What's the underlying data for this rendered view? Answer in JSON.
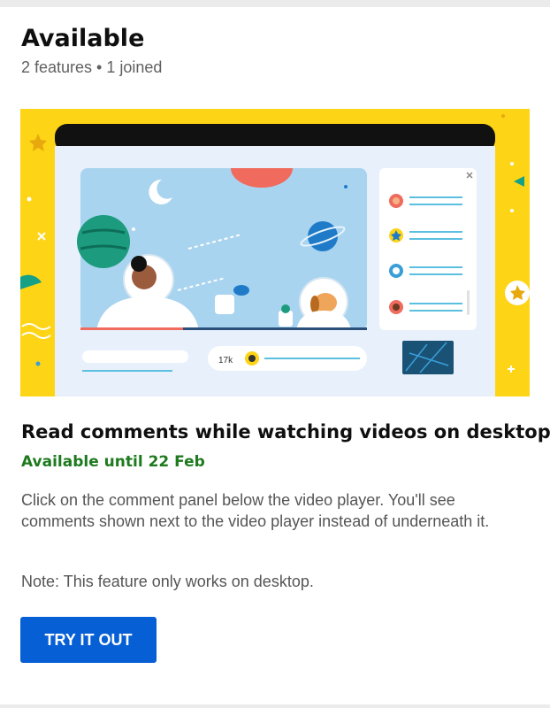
{
  "header": {
    "title": "Available",
    "subtitle": "2 features • 1 joined"
  },
  "illustration": {
    "view_count": "17k"
  },
  "feature": {
    "title": "Read comments while watching videos on desktop",
    "availability": "Available until 22 Feb",
    "description": "Click on the comment panel below the video player. You'll see comments shown next to the video player instead of underneath it.",
    "note": "Note: This feature only works on desktop.",
    "cta_label": "TRY IT OUT"
  },
  "colors": {
    "accent_blue": "#065fd4",
    "availability_green": "#1e7a1e",
    "hero_background_yellow": "#fed416"
  }
}
